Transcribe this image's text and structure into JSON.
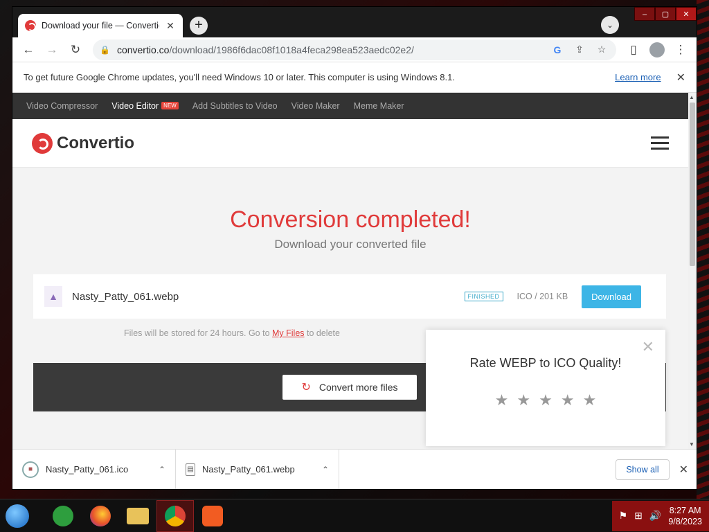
{
  "browser": {
    "tab_title": "Download your file — Convertio",
    "url_host": "convertio.co",
    "url_path": "/download/1986f6dac08f1018a4feca298ea523aedc02e2/"
  },
  "infobar": {
    "message": "To get future Google Chrome updates, you'll need Windows 10 or later. This computer is using Windows 8.1.",
    "link": "Learn more"
  },
  "topnav": {
    "items": [
      "Video Compressor",
      "Video Editor",
      "Add Subtitles to Video",
      "Video Maker",
      "Meme Maker"
    ],
    "new_badge": "NEW"
  },
  "header": {
    "logo_text": "Convertio"
  },
  "hero": {
    "title": "Conversion completed!",
    "subtitle": "Download your converted file"
  },
  "file": {
    "name": "Nasty_Patty_061.webp",
    "status": "FINISHED",
    "meta": "ICO / 201 KB",
    "download_label": "Download"
  },
  "store_note": {
    "before": "Files will be stored for 24 hours. Go to ",
    "link": "My Files",
    "after": " to delete"
  },
  "convert_more": "Convert more files",
  "rating": {
    "title": "Rate WEBP to ICO Quality!",
    "stars": 5
  },
  "downloads": [
    {
      "name": "Nasty_Patty_061.ico"
    },
    {
      "name": "Nasty_Patty_061.webp"
    }
  ],
  "download_bar": {
    "show_all": "Show all"
  },
  "taskbar": {
    "time": "8:27 AM",
    "date": "9/8/2023"
  },
  "colors": {
    "brand": "#e03a3a",
    "download": "#3db5e6",
    "accent_red": "#8a1010"
  }
}
